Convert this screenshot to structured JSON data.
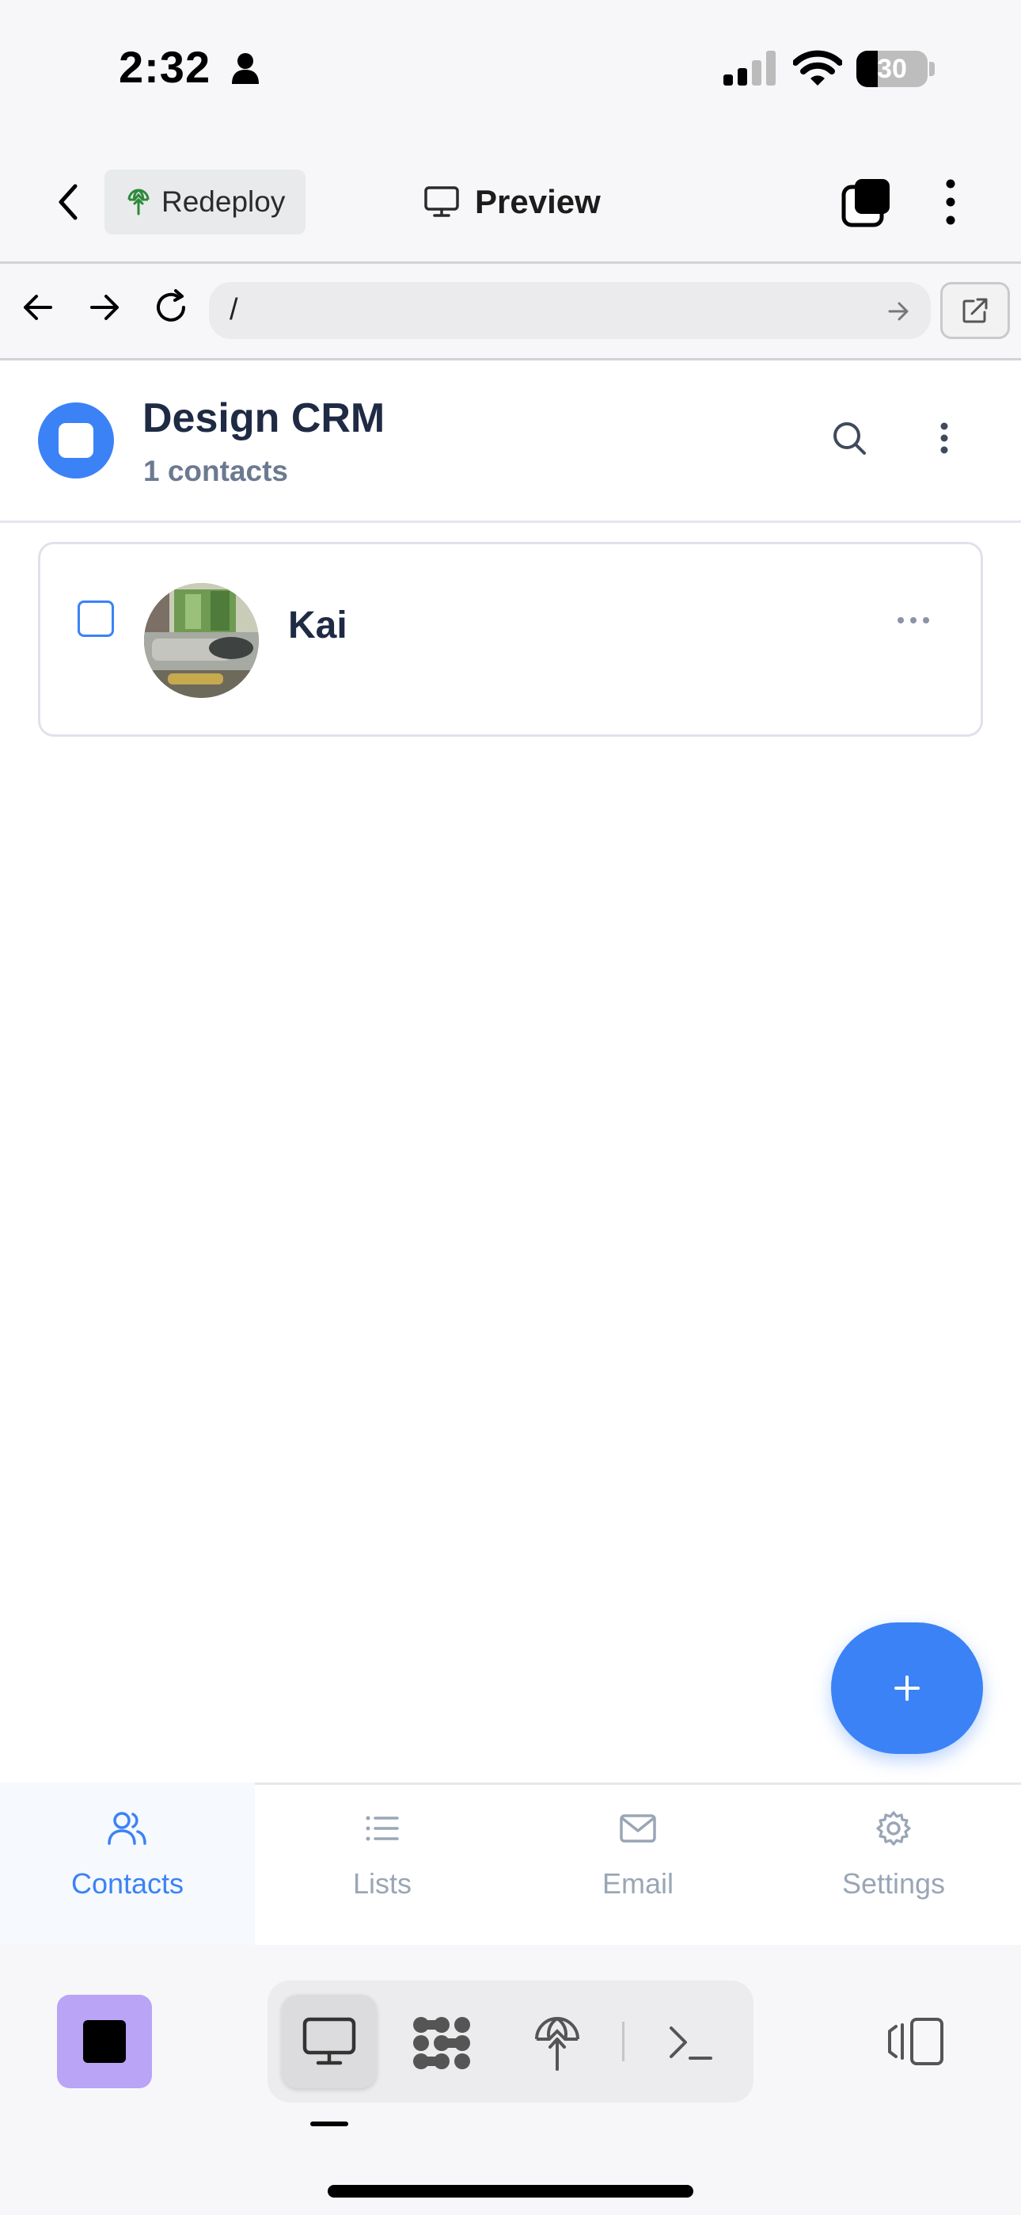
{
  "status_bar": {
    "time": "2:32",
    "battery": "30"
  },
  "app_header": {
    "redeploy_label": "Redeploy",
    "title": "Preview"
  },
  "browser": {
    "url": "/"
  },
  "crm": {
    "title": "Design CRM",
    "subtitle": "1 contacts"
  },
  "contacts": [
    {
      "name": "Kai"
    }
  ],
  "bottom_nav": [
    {
      "label": "Contacts",
      "icon": "users-icon",
      "active": true
    },
    {
      "label": "Lists",
      "icon": "list-icon",
      "active": false
    },
    {
      "label": "Email",
      "icon": "mail-icon",
      "active": false
    },
    {
      "label": "Settings",
      "icon": "gear-icon",
      "active": false
    }
  ],
  "colors": {
    "accent": "#3b82f6",
    "purple": "#b9a4f6",
    "text": "#1f2a44",
    "muted": "#9aa6b6"
  }
}
